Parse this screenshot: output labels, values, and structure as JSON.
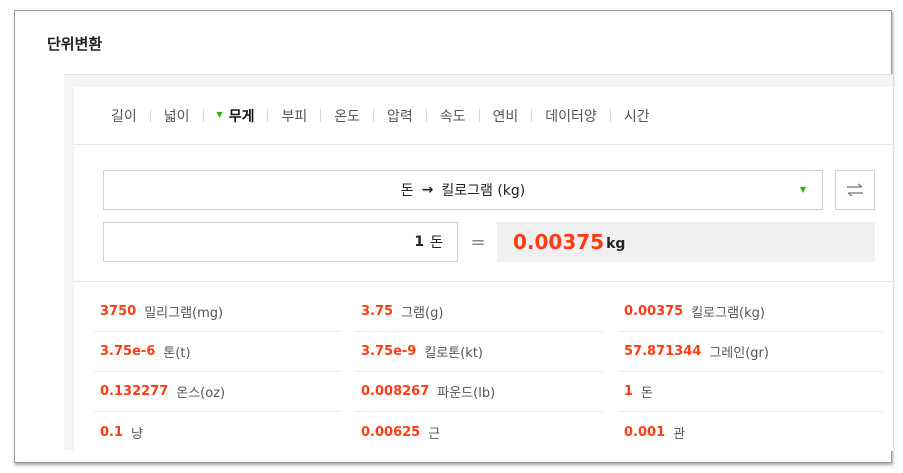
{
  "title": "단위변환",
  "tabs": [
    {
      "label": "길이",
      "active": false
    },
    {
      "label": "넓이",
      "active": false
    },
    {
      "label": "무게",
      "active": true
    },
    {
      "label": "부피",
      "active": false
    },
    {
      "label": "온도",
      "active": false
    },
    {
      "label": "압력",
      "active": false
    },
    {
      "label": "속도",
      "active": false
    },
    {
      "label": "연비",
      "active": false
    },
    {
      "label": "데이터양",
      "active": false
    },
    {
      "label": "시간",
      "active": false
    }
  ],
  "selector": {
    "from": "돈",
    "arrow": "→",
    "to": "킬로그램 (kg)"
  },
  "input": {
    "value": "1",
    "unit": "돈"
  },
  "equals": "=",
  "result": {
    "value": "0.00375",
    "unit": "kg"
  },
  "conversions": [
    {
      "value": "3750",
      "unit": "밀리그램(mg)"
    },
    {
      "value": "3.75",
      "unit": "그램(g)"
    },
    {
      "value": "0.00375",
      "unit": "킬로그램(kg)"
    },
    {
      "value": "3.75e-6",
      "unit": "톤(t)"
    },
    {
      "value": "3.75e-9",
      "unit": "킬로톤(kt)"
    },
    {
      "value": "57.871344",
      "unit": "그레인(gr)"
    },
    {
      "value": "0.132277",
      "unit": "온스(oz)"
    },
    {
      "value": "0.008267",
      "unit": "파운드(lb)"
    },
    {
      "value": "1",
      "unit": "돈"
    },
    {
      "value": "0.1",
      "unit": "냥"
    },
    {
      "value": "0.00625",
      "unit": "근"
    },
    {
      "value": "0.001",
      "unit": "관"
    }
  ],
  "colors": {
    "accent": "#ff3c14",
    "active_dot": "#2db400"
  },
  "icons": {
    "swap": "swap-icon",
    "dropdown": "chevron-down-icon"
  }
}
